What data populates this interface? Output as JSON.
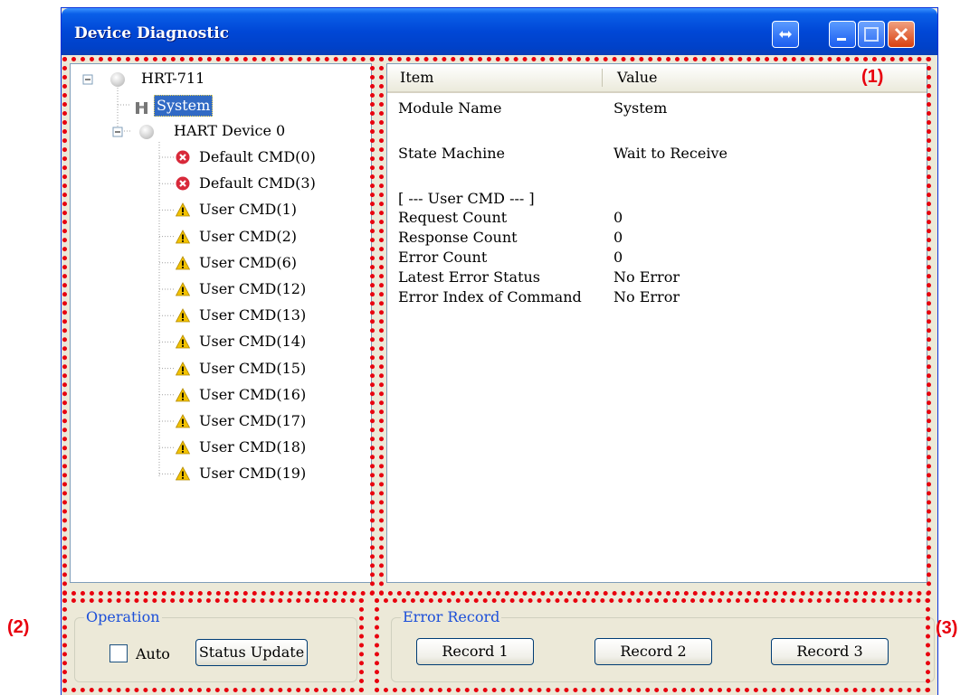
{
  "window": {
    "title": "Device Diagnostic"
  },
  "tree": {
    "root": "HRT-711",
    "system": "System",
    "device": "HART Device 0",
    "commands": [
      {
        "label": "Default CMD(0)",
        "status": "error"
      },
      {
        "label": "Default CMD(3)",
        "status": "error"
      },
      {
        "label": "User CMD(1)",
        "status": "warning"
      },
      {
        "label": "User CMD(2)",
        "status": "warning"
      },
      {
        "label": "User CMD(6)",
        "status": "warning"
      },
      {
        "label": "User CMD(12)",
        "status": "warning"
      },
      {
        "label": "User CMD(13)",
        "status": "warning"
      },
      {
        "label": "User CMD(14)",
        "status": "warning"
      },
      {
        "label": "User CMD(15)",
        "status": "warning"
      },
      {
        "label": "User CMD(16)",
        "status": "warning"
      },
      {
        "label": "User CMD(17)",
        "status": "warning"
      },
      {
        "label": "User CMD(18)",
        "status": "warning"
      },
      {
        "label": "User CMD(19)",
        "status": "warning"
      }
    ]
  },
  "details": {
    "columns": {
      "item": "Item",
      "value": "Value"
    },
    "rows": [
      {
        "item": "Module Name",
        "value": "System"
      },
      {
        "item": "State Machine",
        "value": "Wait to Receive"
      },
      {
        "item": "[ --- User CMD --- ]",
        "value": ""
      },
      {
        "item": "Request Count",
        "value": "0"
      },
      {
        "item": "Response Count",
        "value": "0"
      },
      {
        "item": "Error Count",
        "value": "0"
      },
      {
        "item": "Latest Error Status",
        "value": "No Error"
      },
      {
        "item": "Error Index of Command",
        "value": "No Error"
      }
    ]
  },
  "operation": {
    "legend": "Operation",
    "auto_label": "Auto",
    "auto_checked": false,
    "status_update_label": "Status Update"
  },
  "error_record": {
    "legend": "Error Record",
    "buttons": [
      "Record 1",
      "Record 2",
      "Record 3"
    ]
  },
  "callouts": [
    "(1)",
    "(2)",
    "(3)"
  ],
  "colors": {
    "callout": "#e8000e",
    "titlebar": "#0047d6",
    "selection": "#316ac5",
    "error_icon": "#d8293a",
    "warning_icon": "#f2c200"
  }
}
